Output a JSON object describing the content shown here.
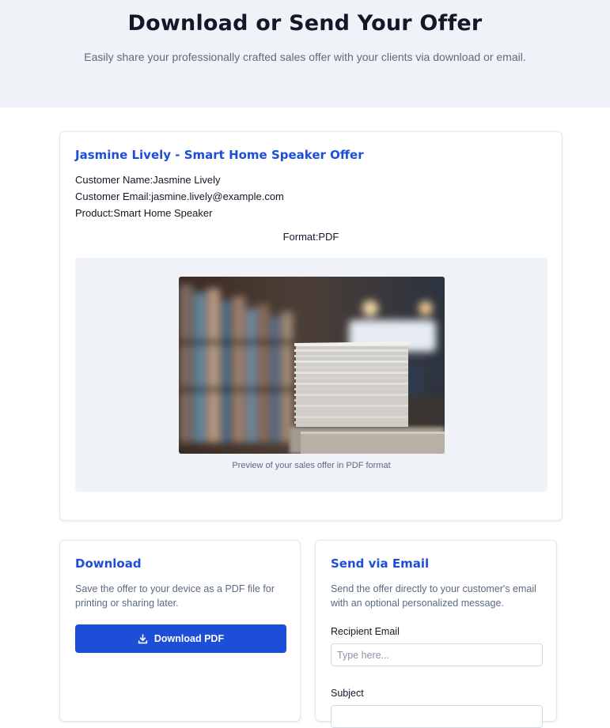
{
  "header": {
    "title": "Download or Send Your Offer",
    "subtitle": "Easily share your professionally crafted sales offer with your clients via download or email."
  },
  "offer": {
    "title": "Jasmine Lively - Smart Home Speaker Offer",
    "customer_name": "Customer Name:Jasmine Lively",
    "customer_email": "Customer Email:jasmine.lively@example.com",
    "product": "Product:Smart Home Speaker",
    "format": "Format:PDF",
    "preview_caption": "Preview of your sales offer in PDF format",
    "preview_image_icon": "photo-stack-of-papers"
  },
  "download": {
    "title": "Download",
    "description": "Save the offer to your device as a PDF file for printing or sharing later.",
    "button_label": "Download PDF",
    "button_icon": "download-icon"
  },
  "email": {
    "title": "Send via Email",
    "description": "Send the offer directly to your customer's email with an optional personalized message.",
    "recipient_label": "Recipient Email",
    "recipient_placeholder": "Type here...",
    "recipient_value": "",
    "subject_label": "Subject"
  },
  "colors": {
    "accent": "#1d4ed8",
    "hero_bg": "#eff2f7",
    "muted_text": "#5b6b80"
  }
}
